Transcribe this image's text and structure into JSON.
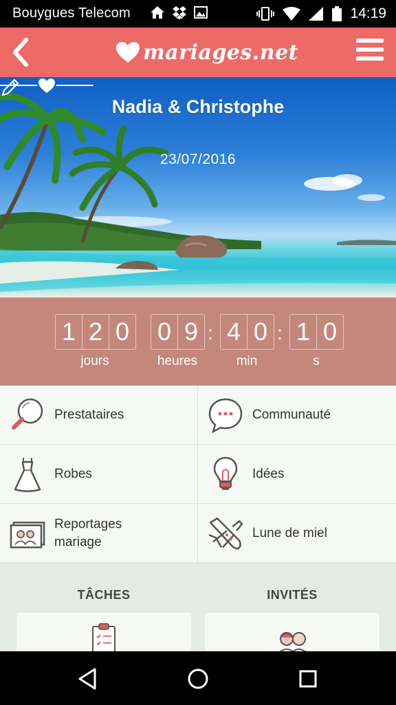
{
  "status_bar": {
    "carrier": "Bouygues Telecom",
    "time": "14:19",
    "icons": [
      "home-icon",
      "dropbox-icon",
      "image-icon",
      "vibrate-icon",
      "wifi-icon",
      "signal-icon",
      "battery-icon"
    ]
  },
  "header": {
    "logo_text": "mariages.net",
    "back_icon": "chevron-left-icon",
    "menu_icon": "hamburger-menu-icon",
    "color": "#ec6b67"
  },
  "hero": {
    "couple": "Nadia & Christophe",
    "date": "23/07/2016",
    "edit_icon": "pencil-icon"
  },
  "countdown": {
    "days": [
      "1",
      "2",
      "0"
    ],
    "hours": [
      "0",
      "9"
    ],
    "minutes": [
      "4",
      "0"
    ],
    "seconds": [
      "1",
      "0"
    ],
    "labels": {
      "days": "jours",
      "hours": "heures",
      "minutes": "min",
      "seconds": "s"
    },
    "background": "#c4877c"
  },
  "menu_grid": [
    {
      "label": "Prestataires",
      "icon": "magnifier-icon"
    },
    {
      "label": "Communauté",
      "icon": "speech-bubble-icon"
    },
    {
      "label": "Robes",
      "icon": "dress-icon"
    },
    {
      "label": "Idées",
      "icon": "lightbulb-icon"
    },
    {
      "label_line1": "Reportages",
      "label_line2": "mariage",
      "icon": "photos-icon"
    },
    {
      "label": "Lune de miel",
      "icon": "airplane-icon"
    }
  ],
  "sections": {
    "tasks": {
      "title": "TÂCHES",
      "icon": "clipboard-icon"
    },
    "guests": {
      "title": "INVITÉS",
      "icon": "people-icon"
    }
  },
  "nav_bar": {
    "icons": [
      "back-triangle-icon",
      "home-circle-icon",
      "recents-square-icon"
    ]
  }
}
